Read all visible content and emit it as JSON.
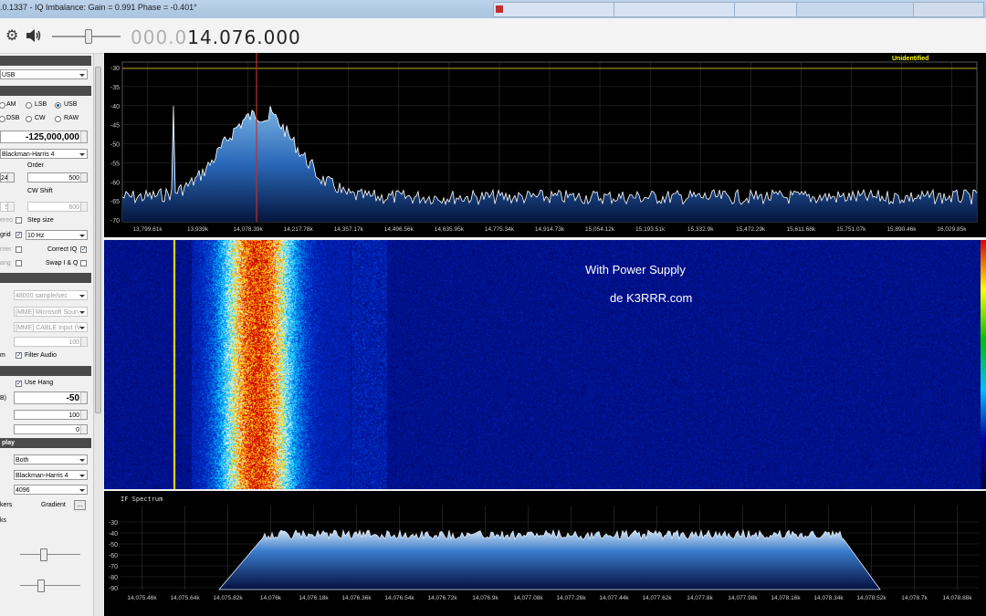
{
  "window": {
    "title": ".0.1337 - IQ Imbalance: Gain = 0.991 Phase = -0.401°",
    "taskbar_tabs": [
      "",
      "",
      "",
      ""
    ]
  },
  "toolbar": {
    "frequency_dim": "000.0",
    "frequency_active": "14.076.000",
    "icons": [
      "gear-icon",
      "speaker-icon"
    ]
  },
  "sidebar": {
    "radio_header": "",
    "mode_combo": "USB",
    "mode_header": "",
    "modes": [
      "AM",
      "LSB",
      "USB",
      "DSB",
      "CW",
      "RAW"
    ],
    "selected_mode": "USB",
    "shift_value": "-125,000,000",
    "filter_combo": "Blackman-Harris 4",
    "bandwidth_value": "2400",
    "order_label": "Order",
    "order_value": "500",
    "cw_shift_label": "CW Shift",
    "cw_shift_left": "50",
    "cw_shift_value": "600",
    "stereo_label": "ereo",
    "step_size_label": "Step size",
    "snap_grid_label": "grid",
    "step_combo": "10 Hz",
    "carrier_label": "rrier",
    "correct_iq_label": "Correct IQ",
    "swap_iq_label": "Swap I & Q",
    "lock_label": "ang",
    "audio_header": "",
    "samplerate_combo": "48000 sample/sec",
    "input_combo": "[MME] Microsoft Soun",
    "output_combo": "[MME] CABLE Input (V",
    "latency_value": "100",
    "filter_audio_pre": "m",
    "filter_audio_label": "Filter Audio",
    "agc_header": "",
    "use_hang_label": "Use Hang",
    "threshold_label": "B)",
    "threshold_value": "-50",
    "decay_value": "100",
    "slope_value": "0",
    "display_header": "play",
    "view_combo": "Both",
    "window_combo": "Blackman-Harris 4",
    "resolution_combo": "4096",
    "markers_label": "kers",
    "gradient_label": "Gradient",
    "gradient_button": "...",
    "peaks_label": "ks"
  },
  "fft": {
    "y_ticks": [
      "-30",
      "-35",
      "-40",
      "-45",
      "-50",
      "-55",
      "-60",
      "-65",
      "-70"
    ],
    "x_ticks": [
      "13,799.61k",
      "13,939k",
      "14,078.39k",
      "14,217.78k",
      "14,357.17k",
      "14,496.56k",
      "14,635.95k",
      "14,775.34k",
      "14,914.73k",
      "15,054.12k",
      "15,193.51k",
      "15,332.9k",
      "15,472.29k",
      "15,611.68k",
      "15,751.07k",
      "15,890.46k",
      "16,029.85k"
    ],
    "label": "Unidentified",
    "colors": {
      "trace": "#ffffff",
      "fill_top": "#6ea8d8",
      "fill_bottom": "#08205a",
      "grid": "#3a3a3a",
      "marker": "#c0302a"
    }
  },
  "waterfall": {
    "line1": "With Power Supply",
    "line2": "de K3RRR.com"
  },
  "if_spectrum": {
    "title": "IF Spectrum",
    "y_ticks": [
      "-30",
      "-40",
      "-50",
      "-60",
      "-70",
      "-80",
      "-90"
    ],
    "x_ticks": [
      "14,075.46k",
      "14,075.64k",
      "14,075.82k",
      "14,076k",
      "14,076.18k",
      "14,076.36k",
      "14,076.54k",
      "14,076.72k",
      "14,076.9k",
      "14,077.08k",
      "14,077.26k",
      "14,077.44k",
      "14,077.62k",
      "14,077.8k",
      "14,077.98k",
      "14,078.16k",
      "14,078.34k",
      "14,078.52k",
      "14,078.7k",
      "14,078.88k"
    ]
  }
}
